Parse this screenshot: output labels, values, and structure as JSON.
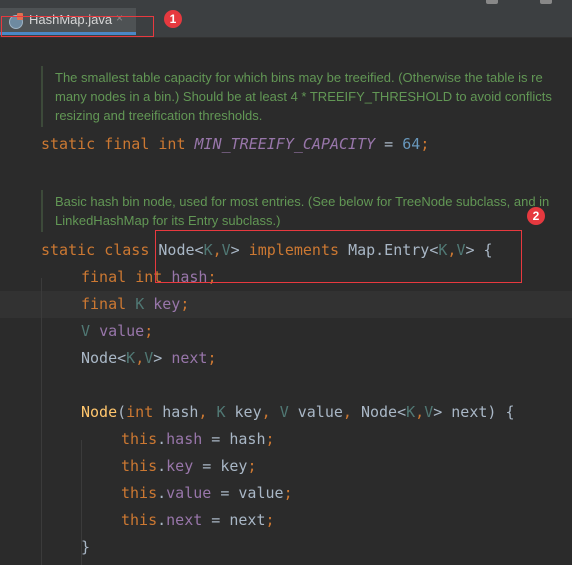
{
  "tab": {
    "filename": "HashMap.java",
    "close_glyph": "×"
  },
  "annotations": {
    "badge1": "1",
    "badge2": "2",
    "color": "#e6393f"
  },
  "doc1": {
    "line1": "The smallest table capacity for which bins may be treeified. (Otherwise the table is re",
    "line2": "many nodes in a bin.) Should be at least 4 * TREEIFY_THRESHOLD to avoid conflicts",
    "line3": "resizing and treeification thresholds."
  },
  "doc2": {
    "line1": "Basic hash bin node, used for most entries. (See below for TreeNode subclass, and in",
    "line2": "LinkedHashMap for its Entry subclass.)"
  },
  "code": {
    "l1": {
      "static": "static",
      "final": "final",
      "int": "int",
      "name": "MIN_TREEIFY_CAPACITY",
      "eq": " = ",
      "value": "64",
      "semi": ";"
    },
    "l2": {
      "static": "static",
      "class": "class",
      "Node": "Node",
      "lt": "<",
      "K": "K",
      "comma": ",",
      "V": "V",
      "gt": ">",
      "implements": "implements",
      "MapEntry": "Map.Entry",
      "lt2": "<",
      "K2": "K",
      "comma2": ",",
      "V2": "V",
      "gt2": ">",
      "brace": " {"
    },
    "l3": {
      "final": "final",
      "int": "int",
      "hash": "hash",
      "semi": ";"
    },
    "l4": {
      "final": "final",
      "K": "K",
      "key": "key",
      "semi": ";"
    },
    "l5": {
      "V": "V",
      "value": "value",
      "semi": ";"
    },
    "l6": {
      "Node": "Node",
      "lt": "<",
      "K": "K",
      "comma": ",",
      "V": "V",
      "gt": ">",
      "next": "next",
      "semi": ";"
    },
    "l7": {
      "Node": "Node",
      "open": "(",
      "int": "int",
      "hash": " hash",
      "c1": ", ",
      "K": "K",
      "key": " key",
      "c2": ", ",
      "V": "V",
      "value": " value",
      "c3": ", ",
      "Node2": "Node",
      "lt": "<",
      "K2": "K",
      "comma": ",",
      "V2": "V",
      "gt": ">",
      "next": " next",
      "close": ") {"
    },
    "l8": {
      "this": "this",
      "dot": ".",
      "field": "hash",
      "rest": " = hash",
      "semi": ";"
    },
    "l9": {
      "this": "this",
      "dot": ".",
      "field": "key",
      "rest": " = key",
      "semi": ";"
    },
    "l10": {
      "this": "this",
      "dot": ".",
      "field": "value",
      "rest": " = value",
      "semi": ";"
    },
    "l11": {
      "this": "this",
      "dot": ".",
      "field": "next",
      "rest": " = next",
      "semi": ";"
    },
    "l12": {
      "brace": "}"
    }
  }
}
